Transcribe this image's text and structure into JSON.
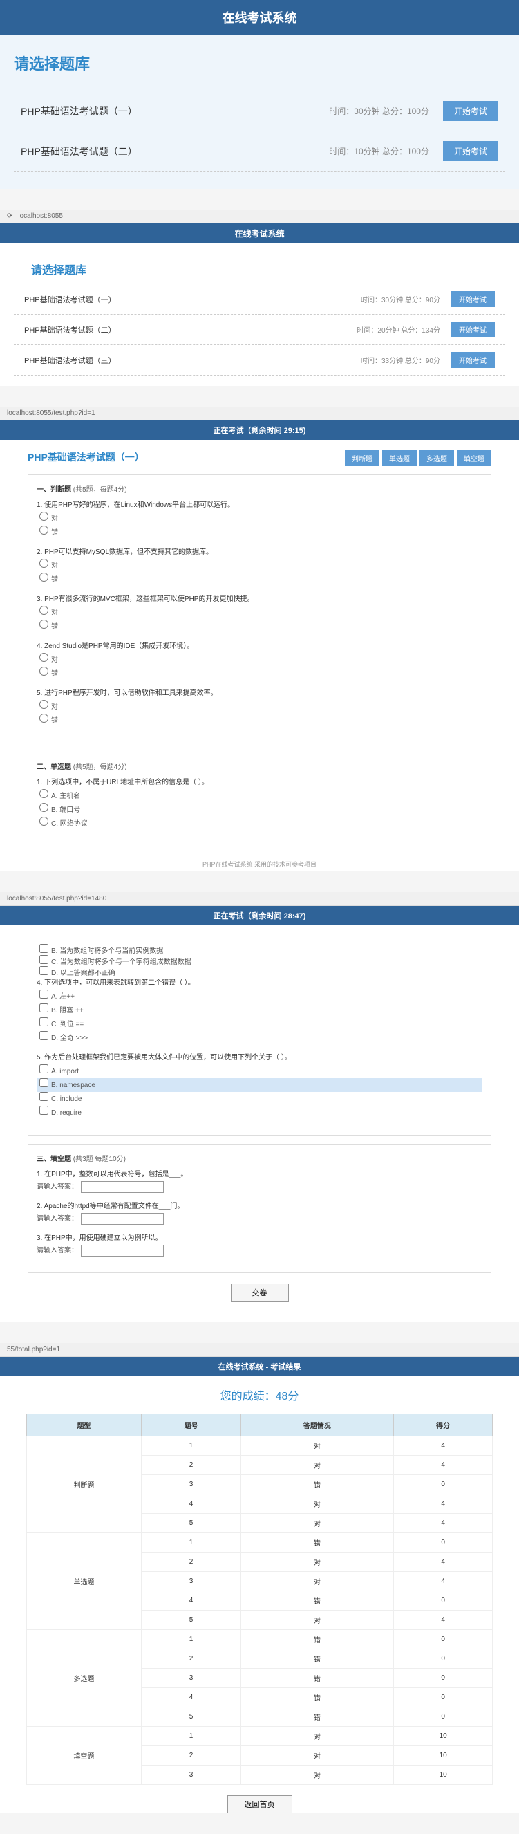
{
  "s1": {
    "header": "在线考试系统",
    "heading": "请选择题库",
    "rows": [
      {
        "name": "PHP基础语法考试题（一）",
        "meta": "时间：30分钟 总分：100分",
        "btn": "开始考试"
      },
      {
        "name": "PHP基础语法考试题（二）",
        "meta": "时间：10分钟 总分：100分",
        "btn": "开始考试"
      }
    ]
  },
  "s2": {
    "url": "localhost:8055",
    "header": "在线考试系统",
    "heading": "请选择题库",
    "rows": [
      {
        "name": "PHP基础语法考试题（一）",
        "meta": "时间：30分钟 总分：90分",
        "btn": "开始考试"
      },
      {
        "name": "PHP基础语法考试题（二）",
        "meta": "时间：20分钟 总分：134分",
        "btn": "开始考试"
      },
      {
        "name": "PHP基础语法考试题（三）",
        "meta": "时间：33分钟 总分：90分",
        "btn": "开始考试"
      }
    ]
  },
  "s3": {
    "url": "localhost:8055/test.php?id=1",
    "header": "正在考试（剩余时间 29:15)",
    "title": "PHP基础语法考试题（一）",
    "nav": [
      "判断题",
      "单选题",
      "多选题",
      "填空题"
    ],
    "sec1": {
      "title": "一、判断题",
      "sub": "(共5题，每题4分)",
      "qs": [
        {
          "t": "1. 使用PHP写好的程序，在Linux和Windows平台上都可以运行。",
          "opts": [
            "对",
            "错"
          ]
        },
        {
          "t": "2. PHP可以支持MySQL数据库，但不支持其它的数据库。",
          "opts": [
            "对",
            "错"
          ]
        },
        {
          "t": "3. PHP有很多流行的MVC框架，这些框架可以使PHP的开发更加快捷。",
          "opts": [
            "对",
            "错"
          ]
        },
        {
          "t": "4. Zend Studio是PHP常用的IDE（集成开发环境）。",
          "opts": [
            "对",
            "错"
          ]
        },
        {
          "t": "5. 进行PHP程序开发时，可以借助软件和工具来提高效率。",
          "opts": [
            "对",
            "错"
          ]
        }
      ]
    },
    "sec2": {
      "title": "二、单选题",
      "sub": "(共5题，每题4分)",
      "q1": {
        "t": "1. 下列选项中，不属于URL地址中所包含的信息是（  ）。",
        "opts": [
          "A. 主机名",
          "B. 端口号",
          "C. 网络协议"
        ]
      }
    },
    "footer": "PHP在线考试系统 采用的技术可参考项目"
  },
  "s4": {
    "url": "localhost:8055/test.php?id=1480",
    "header": "正在考试（剩余时间 28:47)",
    "cont": [
      "B. 当为数组时将多个与当前实例数据",
      "C. 当为数组时将多个与一个字符组成数据数据",
      "D. 以上答案都不正确"
    ],
    "q4": {
      "t": "4. 下列选项中，可以用来表跳转到第二个错误（  ）。",
      "opts": [
        "A. 左++",
        "B. 阻塞 ++",
        "C. 到位 ==",
        "D. 全奇 >>>"
      ]
    },
    "q5": {
      "t": "5. 作为后台处理框架我们已定要被用大体文件中的位置，可以使用下列个关于（  ）。",
      "opts": [
        "A. import",
        "B. namespace",
        "C. include",
        "D. require"
      ]
    },
    "sec3": {
      "title": "三、填空题",
      "sub": "(共3题 每题10分)",
      "qs": [
        {
          "t": "1. 在PHP中，整数可以用代表符号，包括是___。",
          "label": "请输入答案："
        },
        {
          "t": "2. Apache的httpd等中经常有配置文件在___门。",
          "label": "请输入答案："
        },
        {
          "t": "3. 在PHP中，用使用硬建立以为例所以。",
          "label": "请输入答案："
        }
      ]
    },
    "submit": "交卷"
  },
  "s5": {
    "url": "55/total.php?id=1",
    "header": "在线考试系统 - 考试结果",
    "result_label": "您的成绩：",
    "result_score": "48分",
    "th": [
      "题型",
      "题号",
      "答题情况",
      "得分"
    ],
    "groups": [
      {
        "type": "判断题",
        "rows": [
          [
            "1",
            "对",
            "4"
          ],
          [
            "2",
            "对",
            "4"
          ],
          [
            "3",
            "错",
            "0"
          ],
          [
            "4",
            "对",
            "4"
          ],
          [
            "5",
            "对",
            "4"
          ]
        ]
      },
      {
        "type": "单选题",
        "rows": [
          [
            "1",
            "错",
            "0"
          ],
          [
            "2",
            "对",
            "4"
          ],
          [
            "3",
            "对",
            "4"
          ],
          [
            "4",
            "错",
            "0"
          ],
          [
            "5",
            "对",
            "4"
          ]
        ]
      },
      {
        "type": "多选题",
        "rows": [
          [
            "1",
            "错",
            "0"
          ],
          [
            "2",
            "错",
            "0"
          ],
          [
            "3",
            "错",
            "0"
          ],
          [
            "4",
            "错",
            "0"
          ],
          [
            "5",
            "错",
            "0"
          ]
        ]
      },
      {
        "type": "填空题",
        "rows": [
          [
            "1",
            "对",
            "10"
          ],
          [
            "2",
            "对",
            "10"
          ],
          [
            "3",
            "对",
            "10"
          ]
        ]
      }
    ],
    "back": "返回首页"
  }
}
